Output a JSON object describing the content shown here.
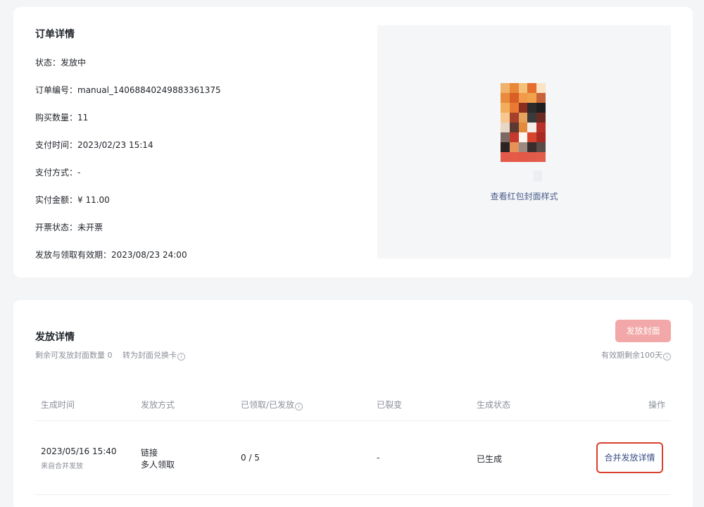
{
  "order": {
    "title": "订单详情",
    "fields": [
      {
        "label": "状态：",
        "value": "发放中"
      },
      {
        "label": "订单编号：",
        "value": "manual_1406884024988336137​5"
      },
      {
        "label": "购买数量：",
        "value": "11"
      },
      {
        "label": "支付时间：",
        "value": "2023/02/23 15:14"
      },
      {
        "label": "支付方式：",
        "value": "-"
      },
      {
        "label": "实付金额：",
        "value": "¥ 11.00"
      },
      {
        "label": "开票状态：",
        "value": "未开票"
      },
      {
        "label": "发放与领取有效期：",
        "value": "2023/08/23 24:00"
      }
    ],
    "cover_link": "查看红包封面样式"
  },
  "distribution": {
    "title": "发放详情",
    "button": "发放封面",
    "remaining": "剩余可发放封面数量 0",
    "convert": "转为封面兑换卡",
    "validity": "有效期剩余100天",
    "columns": [
      "生成时间",
      "发放方式",
      "已领取/已发放",
      "已裂变",
      "生成状态",
      "操作"
    ],
    "rows": [
      {
        "time": "2023/05/16 15:40",
        "time_sub": "来自合并发放",
        "method_line1": "链接",
        "method_line2": "多人领取",
        "received": "0 / 5",
        "fission": "-",
        "status": "已生成",
        "action": "合并发放详情"
      }
    ]
  },
  "colors": {
    "accent_red": "#d9402f",
    "button_disabled": "#f2a8a8",
    "link": "#4a5d8a"
  }
}
